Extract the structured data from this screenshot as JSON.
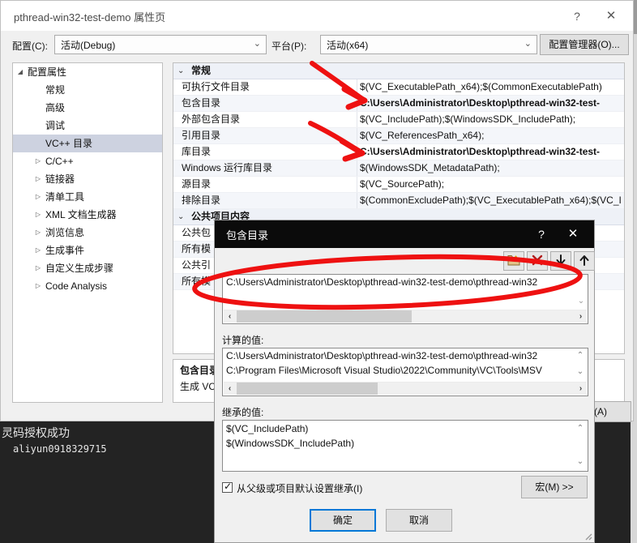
{
  "console": {
    "line1": "灵码授权成功",
    "line2": "aliyun0918329715"
  },
  "property_pages": {
    "title": "pthread-win32-test-demo 属性页",
    "help_icon": "?",
    "close_icon": "✕",
    "config_label": "配置(C):",
    "config_value": "活动(Debug)",
    "platform_label": "平台(P):",
    "platform_value": "活动(x64)",
    "config_manager_button": "配置管理器(O)...",
    "apply_button": "用(A)",
    "tree": [
      {
        "label": "配置属性",
        "indent": 18,
        "arrow": "▲",
        "selected": false
      },
      {
        "label": "常规",
        "indent": 40,
        "arrow": "",
        "selected": false
      },
      {
        "label": "高级",
        "indent": 40,
        "arrow": "",
        "selected": false
      },
      {
        "label": "调试",
        "indent": 40,
        "arrow": "",
        "selected": false
      },
      {
        "label": "VC++ 目录",
        "indent": 40,
        "arrow": "",
        "selected": true
      },
      {
        "label": "C/C++",
        "indent": 40,
        "arrow": "▷",
        "selected": false
      },
      {
        "label": "链接器",
        "indent": 40,
        "arrow": "▷",
        "selected": false
      },
      {
        "label": "清单工具",
        "indent": 40,
        "arrow": "▷",
        "selected": false
      },
      {
        "label": "XML 文档生成器",
        "indent": 40,
        "arrow": "▷",
        "selected": false
      },
      {
        "label": "浏览信息",
        "indent": 40,
        "arrow": "▷",
        "selected": false
      },
      {
        "label": "生成事件",
        "indent": 40,
        "arrow": "▷",
        "selected": false
      },
      {
        "label": "自定义生成步骤",
        "indent": 40,
        "arrow": "▷",
        "selected": false
      },
      {
        "label": "Code Analysis",
        "indent": 40,
        "arrow": "▷",
        "selected": false
      }
    ],
    "groups": [
      {
        "header": "常规",
        "chevron": "⌄",
        "rows": [
          {
            "name": "可执行文件目录",
            "value": "$(VC_ExecutablePath_x64);$(CommonExecutablePath)",
            "bold": false
          },
          {
            "name": "包含目录",
            "value": "C:\\Users\\Administrator\\Desktop\\pthread-win32-test-",
            "bold": true
          },
          {
            "name": "外部包含目录",
            "value": "$(VC_IncludePath);$(WindowsSDK_IncludePath);",
            "bold": false
          },
          {
            "name": "引用目录",
            "value": "$(VC_ReferencesPath_x64);",
            "bold": false
          },
          {
            "name": "库目录",
            "value": "C:\\Users\\Administrator\\Desktop\\pthread-win32-test-",
            "bold": true
          },
          {
            "name": "Windows 运行库目录",
            "value": "$(WindowsSDK_MetadataPath);",
            "bold": false
          },
          {
            "name": "源目录",
            "value": "$(VC_SourcePath);",
            "bold": false
          },
          {
            "name": "排除目录",
            "value": "$(CommonExcludePath);$(VC_ExecutablePath_x64);$(VC_I",
            "bold": false
          }
        ]
      },
      {
        "header": "公共项目内容",
        "chevron": "⌄",
        "rows": [
          {
            "name": "公共包",
            "value": "",
            "bold": false
          },
          {
            "name": "所有模",
            "value": "",
            "bold": false
          },
          {
            "name": "公共引",
            "value": "",
            "bold": false
          },
          {
            "name": "所有模",
            "value": "",
            "bold": false
          }
        ]
      }
    ],
    "description": {
      "title": "包含目录",
      "text": "生成 VC+"
    }
  },
  "dialog": {
    "title": "包含目录",
    "help_icon": "?",
    "close_icon": "✕",
    "toolbar": [
      {
        "name": "new-folder-icon",
        "tooltip": "新行"
      },
      {
        "name": "delete-icon",
        "tooltip": "删除"
      },
      {
        "name": "move-down-icon",
        "tooltip": "下移"
      },
      {
        "name": "move-up-icon",
        "tooltip": "上移"
      }
    ],
    "entries": [
      "C:\\Users\\Administrator\\Desktop\\pthread-win32-test-demo\\pthread-win32"
    ],
    "evaluated_label": "计算的值:",
    "evaluated_values": [
      "C:\\Users\\Administrator\\Desktop\\pthread-win32-test-demo\\pthread-win32",
      "C:\\Program Files\\Microsoft Visual Studio\\2022\\Community\\VC\\Tools\\MSV"
    ],
    "inherited_label": "继承的值:",
    "inherited_values": [
      "$(VC_IncludePath)",
      "$(WindowsSDK_IncludePath)"
    ],
    "inherit_checkbox_label": "从父级或项目默认设置继承(I)",
    "inherit_checkbox_checked": true,
    "macro_button": "宏(M) >>",
    "ok_button": "确定",
    "cancel_button": "取消",
    "scroll_up_icon": "⌃",
    "scroll_down_icon": "⌄",
    "scroll_left_icon": "‹",
    "scroll_right_icon": "›"
  },
  "colors": {
    "accent_blue": "#0078d7",
    "annotation_red": "#ee1111",
    "selection": "#cdd2e0",
    "dialog_titlebar": "#0b0b0b"
  }
}
